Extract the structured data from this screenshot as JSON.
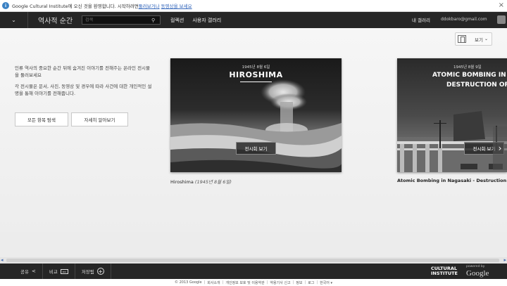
{
  "notice": {
    "text": "Google Cultural Institute에 오신 것을 환영합니다. 시작하려면 ",
    "link1": "둘러보거나",
    "link2": "동영상을 보세요",
    "close": "×"
  },
  "nav": {
    "site_title": "역사적 순간",
    "search_placeholder": "검색",
    "collections": "컬렉션",
    "user_galleries": "사용자 갤러리",
    "my_gallery": "내 갤러리",
    "email": "ddokbaro@gmail.com"
  },
  "view": {
    "label": "보기"
  },
  "intro": {
    "p1": "인류 역사의 중요한 순간 뒤에 숨겨진 이야기를 전해주는 온라인 전시물을 둘러보세요",
    "p2": "각 전시물은 문서, 사진, 동영상 및 경우에 따라 사건에 대한 개인적인 설명을 통해 이야기를 전해줍니다."
  },
  "buttons": {
    "explore_all": "모든 항목 탐색",
    "learn_more": "자세히 알아보기"
  },
  "cards": [
    {
      "date": "1945년 8월 6일",
      "title": "HIROSHIMA",
      "button": "전시회 보기",
      "caption": "Hiroshima",
      "caption_date": "(1945년 8월 6일)"
    },
    {
      "date": "1945년 8월 9일",
      "title_line1": "ATOMIC BOMBING IN NAG",
      "title_line2": "DESTRUCTION OF A C",
      "button": "전시회 보기",
      "caption": "Atomic Bombing in Nagasaki - Destruction of a"
    }
  ],
  "bottom": {
    "share": "공유",
    "compare": "비교",
    "save": "저장됨",
    "logo_line1": "CULTURAL",
    "logo_line2": "INSTITUTE",
    "powered_by": "powered by",
    "google": "Google"
  },
  "footer": {
    "copyright": "© 2013 Google",
    "items": [
      "회사소개",
      "개인정보 보호 및 이용약관",
      "약용기사 신고",
      "정보",
      "로그",
      "한국어 ▾"
    ]
  },
  "colors": {
    "nav_bg": "#262626",
    "notice_link": "#3366bb",
    "info_icon": "#3b82c4"
  }
}
